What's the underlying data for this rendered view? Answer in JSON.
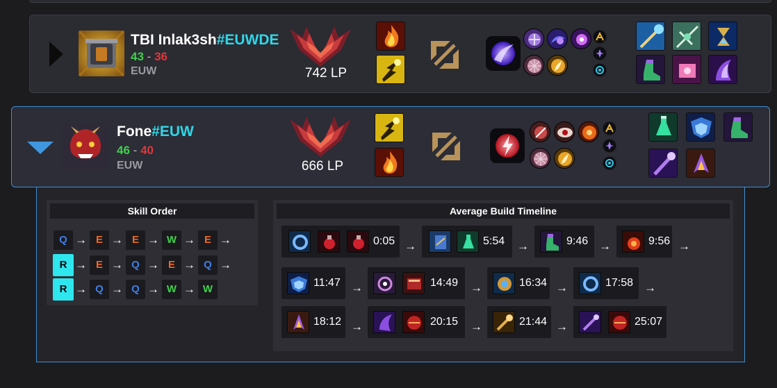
{
  "players": [
    {
      "riot_name": "TBI Inlak3sh",
      "riot_tag": "#EUWDE",
      "wins": "43",
      "dash": "-",
      "losses": "36",
      "region": "EUW",
      "lp": "742 LP",
      "expanded": false
    },
    {
      "riot_name": "Fone",
      "riot_tag": "#EUW",
      "wins": "46",
      "dash": "-",
      "losses": "40",
      "region": "EUW",
      "lp": "666 LP",
      "expanded": true
    }
  ],
  "skill_order": {
    "title": "Skill Order",
    "rows": [
      [
        "Q",
        "E",
        "E",
        "W",
        "E"
      ],
      [
        "R",
        "E",
        "Q",
        "E",
        "Q"
      ],
      [
        "R",
        "Q",
        "Q",
        "W",
        "W"
      ]
    ],
    "arrow": "→"
  },
  "build_timeline": {
    "title": "Average Build Timeline",
    "arrow": "→",
    "steps": [
      {
        "time": "0:05",
        "items": [
          "ring-item-icon",
          "potion-item-icon",
          "potion-item-icon"
        ]
      },
      {
        "time": "5:54",
        "items": [
          "tome-item-icon",
          "elixir-item-icon"
        ]
      },
      {
        "time": "9:46",
        "items": [
          "boots-item-icon"
        ]
      },
      {
        "time": "9:56",
        "items": [
          "refillable-item-icon"
        ]
      },
      {
        "time": "11:47",
        "items": [
          "sorcerer-boots-icon"
        ]
      },
      {
        "time": "14:49",
        "items": [
          "orb-item-icon",
          "book-item-icon"
        ]
      },
      {
        "time": "16:34",
        "items": [
          "catalyst-item-icon"
        ]
      },
      {
        "time": "17:58",
        "items": [
          "ring-item-icon"
        ]
      },
      {
        "time": "18:12",
        "items": [
          "violet-blade-icon"
        ]
      },
      {
        "time": "20:15",
        "items": [
          "dark-seal-icon",
          "crimson-tome-icon"
        ]
      },
      {
        "time": "21:44",
        "items": [
          "golden-staff-icon"
        ]
      },
      {
        "time": "25:07",
        "items": [
          "void-staff-icon",
          "crimson-tome-icon"
        ]
      }
    ]
  },
  "colors": {
    "win": "#3ed24b",
    "loss": "#e0373a",
    "tag": "#2fd7e8",
    "skill_q": "#3f7fe6",
    "skill_e": "#ef6a23",
    "skill_w": "#3ed24b",
    "skill_r_bg": "#2ee6ee",
    "accent": "#3f8fd6"
  }
}
